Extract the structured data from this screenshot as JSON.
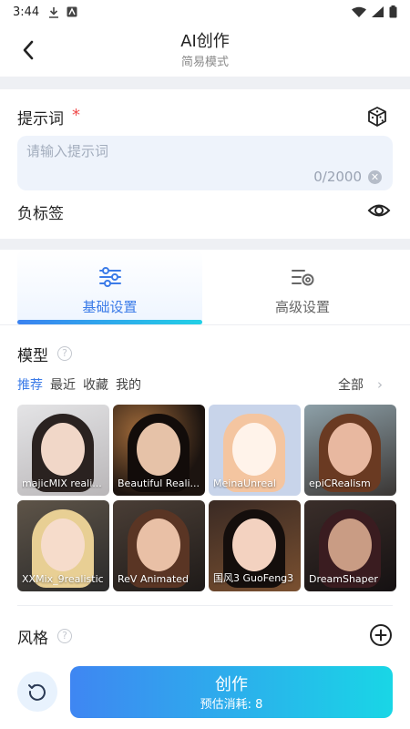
{
  "status_bar": {
    "time": "3:44"
  },
  "header": {
    "title": "AI创作",
    "subtitle": "简易模式"
  },
  "prompt": {
    "label": "提示词",
    "required_mark": "*",
    "placeholder": "请输入提示词",
    "value": "",
    "counter": "0/2000"
  },
  "negative_prompt": {
    "label": "负标签"
  },
  "settings_tabs": [
    {
      "label": "基础设置",
      "active": true
    },
    {
      "label": "高级设置",
      "active": false
    }
  ],
  "model": {
    "title": "模型",
    "help": "?",
    "filters": [
      "推荐",
      "最近",
      "收藏",
      "我的"
    ],
    "all_label": "全部",
    "all_arrow": "›",
    "cards": [
      {
        "name": "majicMIX reali..."
      },
      {
        "name": "Beautiful Reali..."
      },
      {
        "name": "MeinaUnreal"
      },
      {
        "name": "epiCRealism"
      },
      {
        "name": "XXMix_9realistic"
      },
      {
        "name": "ReV Animated"
      },
      {
        "name": "国风3 GuoFeng3"
      },
      {
        "name": "DreamShaper"
      }
    ]
  },
  "style": {
    "title": "风格",
    "help": "?"
  },
  "actions": {
    "create_label": "创作",
    "cost_label": "预估消耗: 8"
  },
  "colors": {
    "accent": "#3b7be8",
    "gradient_start": "#3f86f2",
    "gradient_end": "#19d6e6",
    "required": "#f04b4b"
  }
}
